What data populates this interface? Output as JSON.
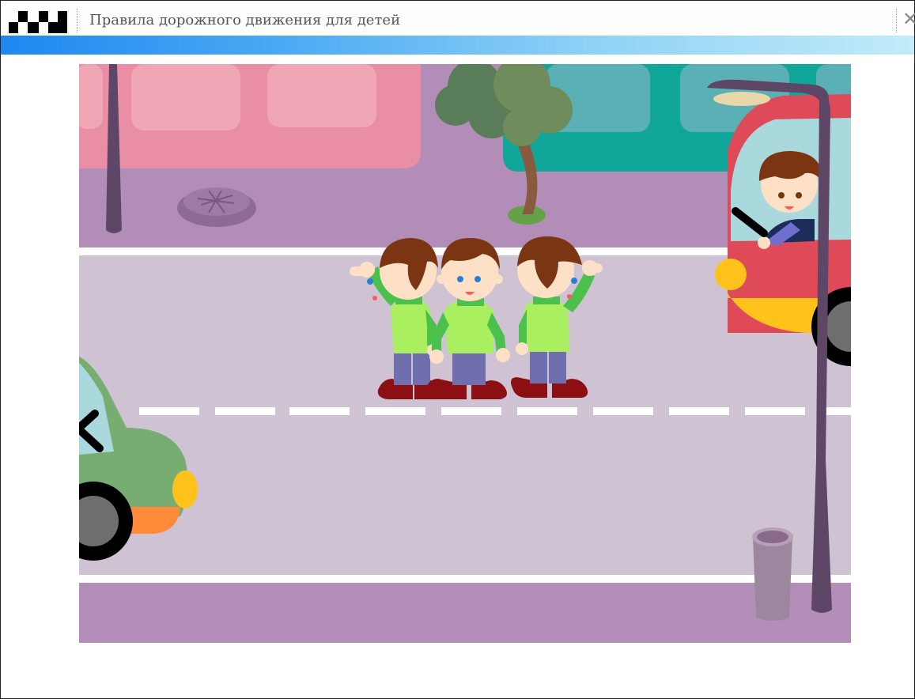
{
  "window": {
    "title": "Правила дорожного движения для детей",
    "close_glyph": "✕"
  },
  "icons": {
    "logo": "checkered-flag-icon",
    "close": "close-icon"
  },
  "colors": {
    "accent_start": "#1e88f0",
    "accent_end": "#c2ebf8",
    "road": "#cfc3d3",
    "sidewalk": "#b28eb8"
  },
  "scene": {
    "name": "street-crossing-scene"
  }
}
